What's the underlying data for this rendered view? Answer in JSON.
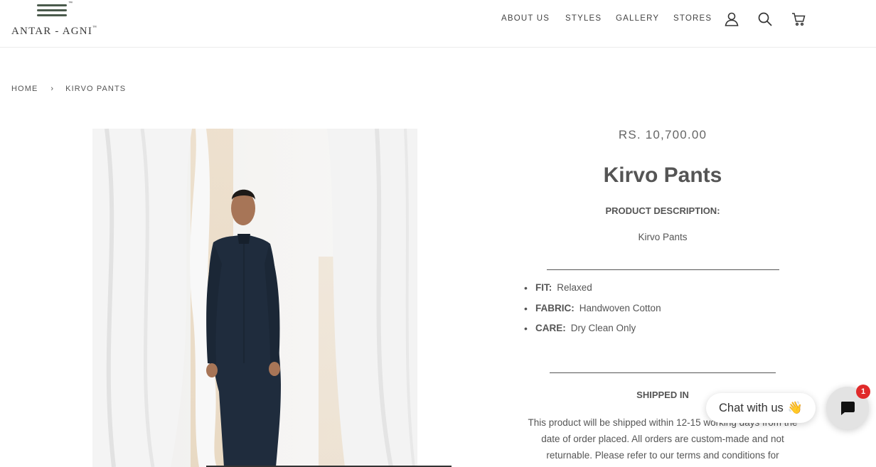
{
  "brand": {
    "name": "ANTAR - AGNI",
    "tm": "™"
  },
  "nav": {
    "about": "ABOUT US",
    "styles": "STYLES",
    "gallery": "GALLERY",
    "stores": "STORES"
  },
  "icons": {
    "account": "user-icon",
    "search": "search-icon",
    "cart": "cart-icon",
    "chat": "chat-bubble-icon"
  },
  "breadcrumb": {
    "home": "HOME",
    "separator": "›",
    "current": "KIRVO PANTS"
  },
  "product": {
    "price": "RS. 10,700.00",
    "title": "Kirvo Pants",
    "description_heading": "PRODUCT DESCRIPTION:",
    "description": "Kirvo Pants",
    "specs": [
      {
        "label": "FIT:",
        "value": "Relaxed"
      },
      {
        "label": "FABRIC:",
        "value": "Handwoven Cotton"
      },
      {
        "label": "CARE:",
        "value": "Dry Clean Only"
      }
    ],
    "shipping_heading": "SHIPPED IN",
    "shipping_text": "This product will be shipped within 12-15 working days from the date of order placed. All orders are custom-made and not returnable. Please refer to our terms and conditions for"
  },
  "chat": {
    "label": "Chat with us",
    "emoji": "👋",
    "badge": "1"
  },
  "colors": {
    "text": "#555555",
    "badge": "#e02a2a",
    "garment": "#1f2c3d",
    "logo_stripes": "#4a5a4c"
  }
}
